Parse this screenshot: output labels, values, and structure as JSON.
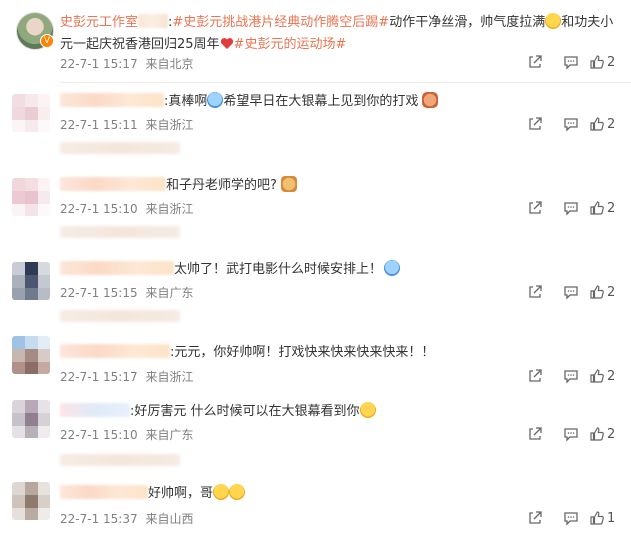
{
  "post": {
    "author": "史彭元工作室",
    "tag1": "#史彭元挑战港片经典动作腾空后踢#",
    "body": "动作干净丝滑，帅气度拉满",
    "body2": "和功夫小元一起庆祝香港回归25周年",
    "tag2": "#史彭元的运动场#",
    "time": "22-7-1 15:17",
    "source": "来自北京",
    "likes": "2"
  },
  "comments": [
    {
      "text": ":真棒啊",
      "text2": "希望早日在大银幕上见到你的打戏",
      "time": "22-7-1 15:11",
      "source": "来自浙江",
      "likes": "2"
    },
    {
      "text": "和子丹老师学的吧?",
      "text2": "",
      "time": "22-7-1 15:10",
      "source": "来自浙江",
      "likes": "2"
    },
    {
      "text": "太帅了！武打电影什么时候安排上！",
      "text2": "",
      "time": "22-7-1 15:15",
      "source": "来自广东",
      "likes": "2"
    },
    {
      "text": ":元元，你好帅啊！打戏快来快来快来快来！！",
      "text2": "",
      "time": "22-7-1 15:17",
      "source": "来自浙江",
      "likes": "2"
    },
    {
      "text": ":好厉害元 什么时候可以在大银幕看到你",
      "text2": "",
      "time": "22-7-1 15:10",
      "source": "来自广东",
      "likes": "2"
    },
    {
      "text": "好帅啊，哥",
      "text2": "",
      "time": "22-7-1 15:37",
      "source": "来自山西",
      "likes": "1"
    }
  ],
  "icons": {
    "share": "share-icon",
    "comment": "comment-icon",
    "like": "thumbs-up-icon",
    "verified": "verified-badge-icon"
  },
  "colors": {
    "link": "#eb7350",
    "meta": "#808080",
    "badge": "#ff8200"
  }
}
